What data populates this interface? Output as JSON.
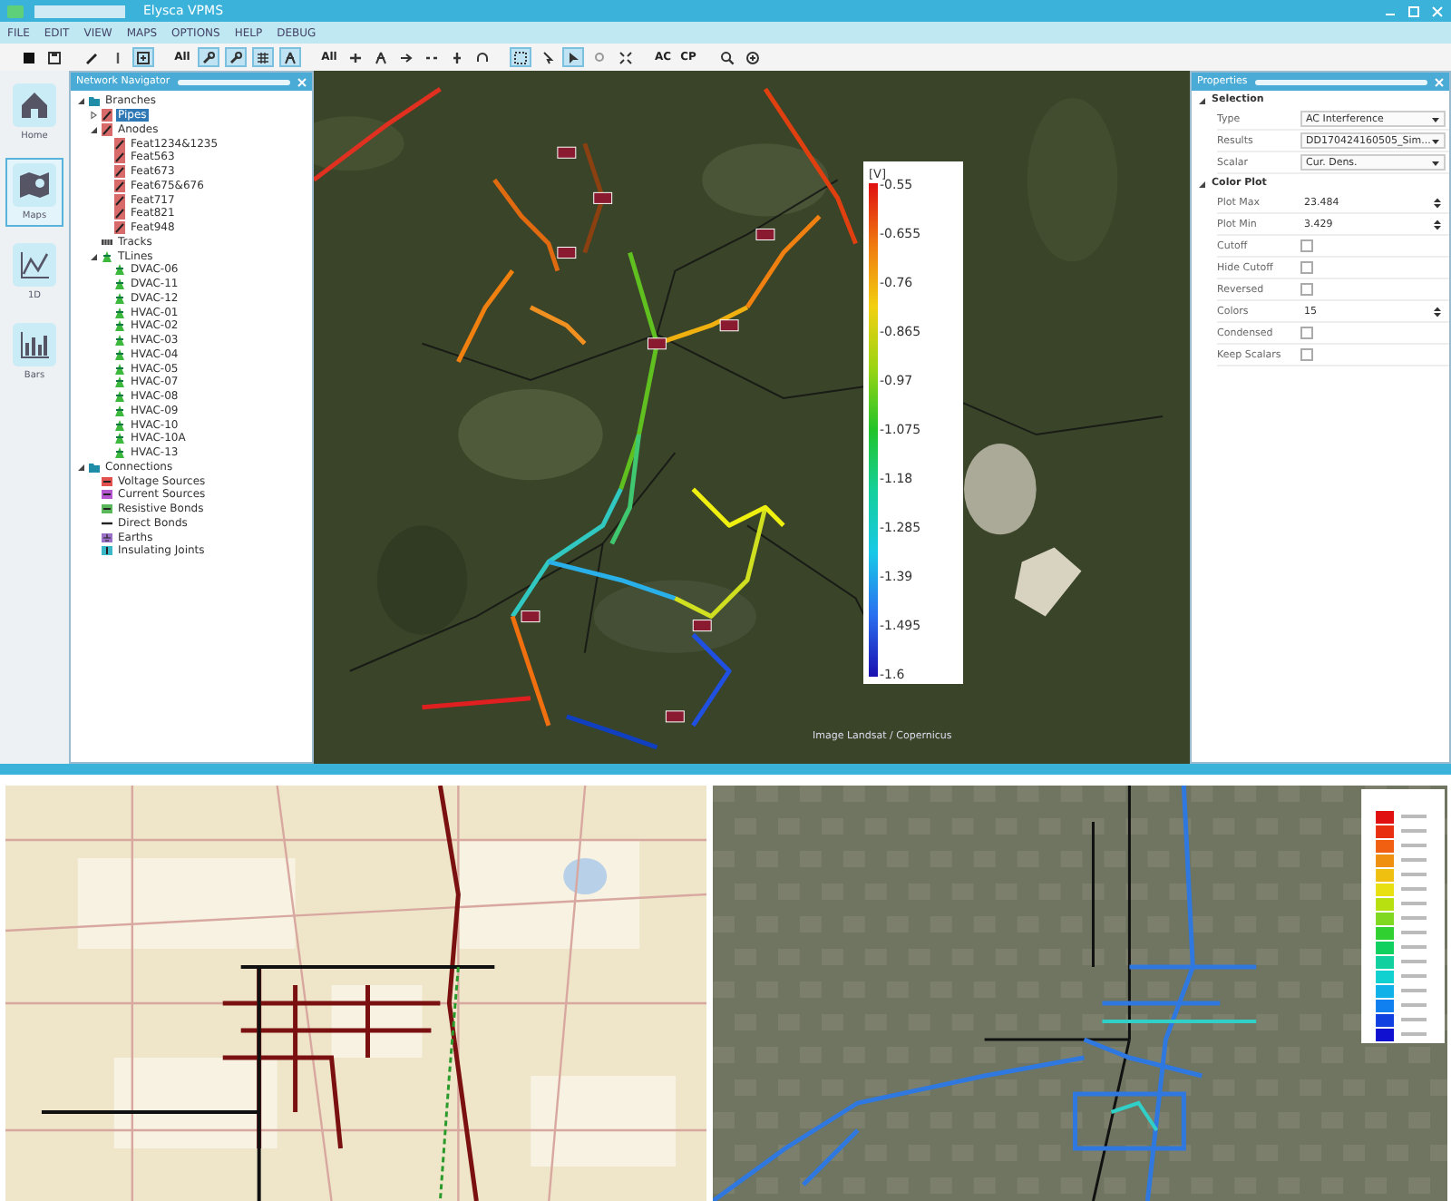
{
  "window": {
    "title": "Elysca VPMS"
  },
  "menu": [
    "FILE",
    "EDIT",
    "VIEW",
    "MAPS",
    "OPTIONS",
    "HELP",
    "DEBUG"
  ],
  "toolbar": [
    [
      {
        "kind": "icon",
        "pressed": false
      },
      {
        "kind": "icon",
        "pressed": false
      }
    ],
    [
      {
        "kind": "icon",
        "pressed": false
      },
      {
        "kind": "icon",
        "pressed": false
      },
      {
        "kind": "icon",
        "pressed": true
      }
    ],
    [
      {
        "kind": "text",
        "label": "All",
        "pressed": false
      },
      {
        "kind": "icon",
        "pressed": true
      },
      {
        "kind": "icon",
        "pressed": true
      },
      {
        "kind": "icon",
        "pressed": true
      },
      {
        "kind": "icon",
        "pressed": true
      }
    ],
    [
      {
        "kind": "text",
        "label": "All",
        "pressed": false
      },
      {
        "kind": "icon",
        "pressed": false
      },
      {
        "kind": "icon",
        "pressed": false
      },
      {
        "kind": "icon",
        "pressed": false
      },
      {
        "kind": "icon",
        "pressed": false
      },
      {
        "kind": "icon",
        "pressed": false
      },
      {
        "kind": "icon",
        "pressed": false
      }
    ],
    [
      {
        "kind": "icon",
        "pressed": true
      },
      {
        "kind": "icon",
        "pressed": false
      },
      {
        "kind": "icon",
        "pressed": true
      },
      {
        "kind": "icon",
        "pressed": false
      },
      {
        "kind": "icon",
        "pressed": false
      }
    ],
    [
      {
        "kind": "text",
        "label": "AC",
        "pressed": false
      },
      {
        "kind": "text",
        "label": "CP",
        "pressed": false
      }
    ],
    [
      {
        "kind": "icon",
        "pressed": false
      },
      {
        "kind": "icon",
        "pressed": false
      }
    ]
  ],
  "sidebar": [
    {
      "kind": "home",
      "label": "Home",
      "selected": false
    },
    {
      "kind": "maps",
      "label": "Maps",
      "selected": true
    },
    {
      "kind": "line",
      "label": "1D",
      "selected": false
    },
    {
      "kind": "bars",
      "label": "Bars",
      "selected": false
    }
  ],
  "navigator": {
    "title": "Network Navigator",
    "tree": [
      {
        "label": "Branches",
        "kind": "folder",
        "expanded": true,
        "selected": false,
        "children": [
          {
            "label": "Pipes",
            "kind": "pipe",
            "expanded": false,
            "selected": true
          },
          {
            "label": "Anodes",
            "kind": "pipe",
            "expanded": true,
            "selected": false,
            "children": [
              {
                "label": "Feat1234&1235",
                "kind": "pipe",
                "selected": false
              },
              {
                "label": "Feat563",
                "kind": "pipe",
                "selected": false
              },
              {
                "label": "Feat673",
                "kind": "pipe",
                "selected": false
              },
              {
                "label": "Feat675&676",
                "kind": "pipe",
                "selected": false
              },
              {
                "label": "Feat717",
                "kind": "pipe",
                "selected": false
              },
              {
                "label": "Feat821",
                "kind": "pipe",
                "selected": false
              },
              {
                "label": "Feat948",
                "kind": "pipe",
                "selected": false
              }
            ]
          },
          {
            "label": "Tracks",
            "kind": "track",
            "selected": false
          },
          {
            "label": "TLines",
            "kind": "tline",
            "expanded": true,
            "selected": false,
            "children": [
              {
                "label": "DVAC-06",
                "kind": "tline",
                "selected": false
              },
              {
                "label": "DVAC-11",
                "kind": "tline",
                "selected": false
              },
              {
                "label": "DVAC-12",
                "kind": "tline",
                "selected": false
              },
              {
                "label": "HVAC-01",
                "kind": "tline",
                "selected": false
              },
              {
                "label": "HVAC-02",
                "kind": "tline",
                "selected": false
              },
              {
                "label": "HVAC-03",
                "kind": "tline",
                "selected": false
              },
              {
                "label": "HVAC-04",
                "kind": "tline",
                "selected": false
              },
              {
                "label": "HVAC-05",
                "kind": "tline",
                "selected": false
              },
              {
                "label": "HVAC-07",
                "kind": "tline",
                "selected": false
              },
              {
                "label": "HVAC-08",
                "kind": "tline",
                "selected": false
              },
              {
                "label": "HVAC-09",
                "kind": "tline",
                "selected": false
              },
              {
                "label": "HVAC-10",
                "kind": "tline",
                "selected": false
              },
              {
                "label": "HVAC-10A",
                "kind": "tline",
                "selected": false
              },
              {
                "label": "HVAC-13",
                "kind": "tline",
                "selected": false
              }
            ]
          }
        ]
      },
      {
        "label": "Connections",
        "kind": "folder",
        "expanded": true,
        "selected": false,
        "children": [
          {
            "label": "Voltage Sources",
            "kind": "voltage",
            "selected": false
          },
          {
            "label": "Current Sources",
            "kind": "current",
            "selected": false
          },
          {
            "label": "Resistive Bonds",
            "kind": "resistive",
            "selected": false
          },
          {
            "label": "Direct Bonds",
            "kind": "direct",
            "selected": false
          },
          {
            "label": "Earths",
            "kind": "earth",
            "selected": false
          },
          {
            "label": "Insulating Joints",
            "kind": "joint",
            "selected": false
          }
        ]
      }
    ]
  },
  "map": {
    "legend": {
      "unit": "[V]",
      "labels": [
        "-0.55",
        "-0.655",
        "-0.76",
        "-0.865",
        "-0.97",
        "-1.075",
        "-1.18",
        "-1.285",
        "-1.39",
        "-1.495",
        "-1.6"
      ]
    },
    "attribution": "Image Landsat / Copernicus"
  },
  "properties": {
    "title": "Properties",
    "sections": [
      {
        "title": "Selection",
        "expanded": true,
        "rows": [
          {
            "label": "Type",
            "kind": "dropdown",
            "value": "AC Interference"
          },
          {
            "label": "Results",
            "kind": "dropdown",
            "value": "DD170424160505_Sim..."
          },
          {
            "label": "Scalar",
            "kind": "dropdown",
            "value": "Cur. Dens."
          }
        ]
      },
      {
        "title": "Color Plot",
        "expanded": true,
        "rows": [
          {
            "label": "Plot Max",
            "kind": "spin",
            "value": "23.484"
          },
          {
            "label": "Plot Min",
            "kind": "spin",
            "value": "3.429"
          },
          {
            "label": "Cutoff",
            "kind": "checkbox",
            "checked": false
          },
          {
            "label": "Hide Cutoff",
            "kind": "checkbox",
            "checked": false
          },
          {
            "label": "Reversed",
            "kind": "checkbox",
            "checked": false
          },
          {
            "label": "Colors",
            "kind": "spin",
            "value": "15"
          },
          {
            "label": "Condensed",
            "kind": "checkbox",
            "checked": false
          },
          {
            "label": "Keep Scalars",
            "kind": "checkbox",
            "checked": false
          }
        ]
      }
    ]
  }
}
